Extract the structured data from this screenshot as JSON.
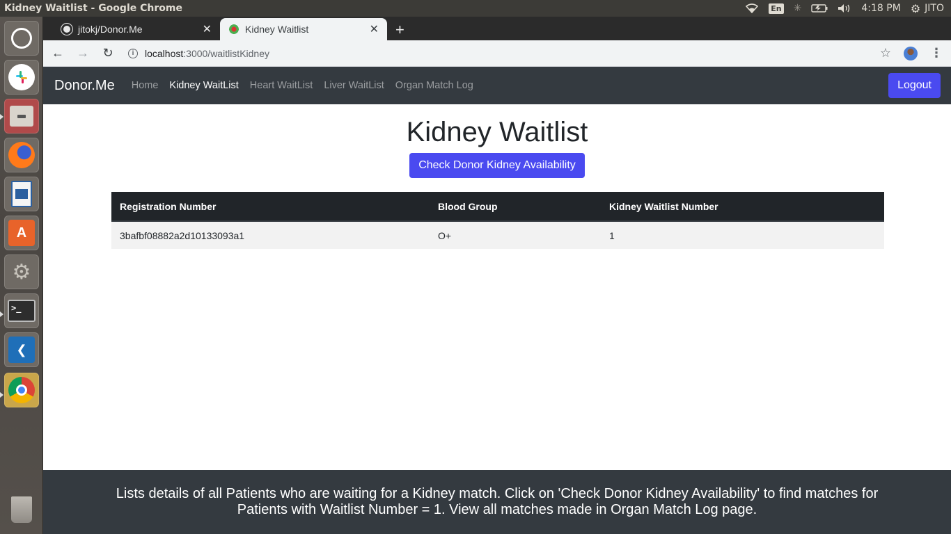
{
  "os": {
    "window_title": "Kidney Waitlist - Google Chrome",
    "keyboard_layout": "En",
    "clock": "4:18 PM",
    "user": "JITO",
    "launcher_apps": [
      "ubuntu-dash",
      "slack",
      "files",
      "firefox",
      "libreoffice-writer",
      "software-center",
      "system-settings",
      "terminal",
      "vscode",
      "chrome",
      "trash"
    ]
  },
  "browser": {
    "tabs": [
      {
        "title": "jitokj/Donor.Me",
        "icon": "github-icon",
        "active": false
      },
      {
        "title": "Kidney Waitlist",
        "icon": "donorme-icon",
        "active": true
      }
    ],
    "url_host": "localhost",
    "url_path": ":3000/waitlistKidney"
  },
  "app": {
    "brand": "Donor.Me",
    "nav": {
      "home": "Home",
      "kidney": "Kidney WaitList",
      "heart": "Heart WaitList",
      "liver": "Liver WaitList",
      "match_log": "Organ Match Log"
    },
    "logout_label": "Logout",
    "page_title": "Kidney Waitlist",
    "check_button_label": "Check Donor Kidney Availability",
    "table": {
      "headers": [
        "Registration Number",
        "Blood Group",
        "Kidney Waitlist Number"
      ],
      "rows": [
        [
          "3bafbf08882a2d10133093a1",
          "O+",
          "1"
        ]
      ]
    },
    "footer_text": "Lists details of all Patients who are waiting for a Kidney match. Click on 'Check Donor Kidney Availability' to find matches for Patients with Waitlist Number = 1. View all matches made in Organ Match Log page."
  },
  "colors": {
    "navbar_bg": "#343a40",
    "primary_button": "#4a4af0",
    "table_header_bg": "#212529",
    "table_row_bg": "#f2f2f2"
  }
}
